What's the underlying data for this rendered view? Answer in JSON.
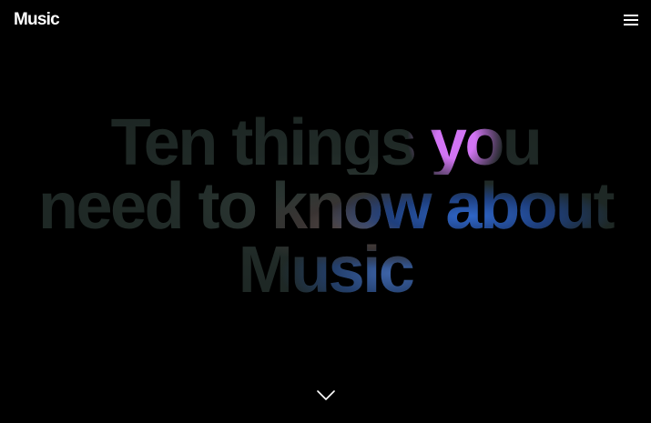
{
  "header": {
    "brand": "Music",
    "menu_icon": "hamburger-menu-icon"
  },
  "hero": {
    "line1": "Ten things you",
    "line2": "need to know about",
    "line3": "Music"
  },
  "scroll": {
    "icon": "chevron-down-icon"
  },
  "colors": {
    "background": "#000000",
    "text_base": "#1f2925",
    "accent_blue": "#2f66c8",
    "accent_pink": "#dc78ff"
  }
}
